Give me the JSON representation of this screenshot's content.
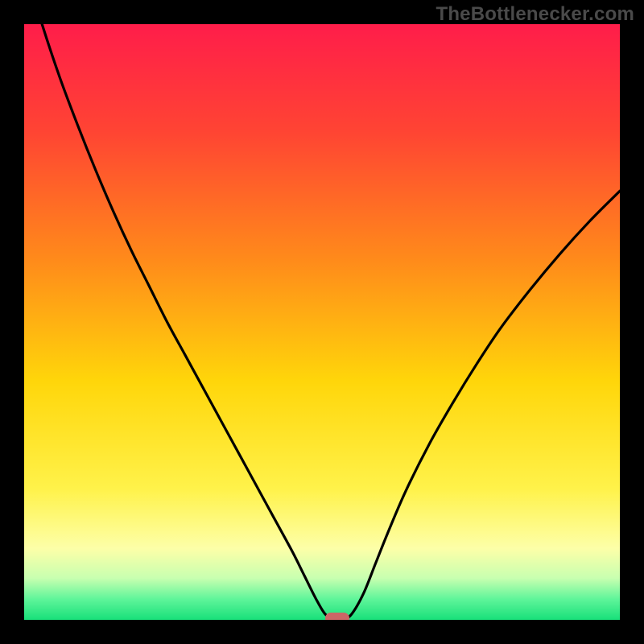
{
  "watermark": "TheBottlenecker.com",
  "chart_data": {
    "type": "line",
    "title": "",
    "xlabel": "",
    "ylabel": "",
    "xlim": [
      0,
      100
    ],
    "ylim": [
      0,
      100
    ],
    "gradient_stops": [
      {
        "offset": 0,
        "color": "#ff1d4a"
      },
      {
        "offset": 0.18,
        "color": "#ff4433"
      },
      {
        "offset": 0.4,
        "color": "#ff8c1a"
      },
      {
        "offset": 0.6,
        "color": "#ffd60a"
      },
      {
        "offset": 0.78,
        "color": "#fff24a"
      },
      {
        "offset": 0.88,
        "color": "#fdffa8"
      },
      {
        "offset": 0.93,
        "color": "#c8ffb0"
      },
      {
        "offset": 0.965,
        "color": "#5ff59a"
      },
      {
        "offset": 1.0,
        "color": "#18e07a"
      }
    ],
    "series": [
      {
        "name": "bottleneck-curve",
        "x": [
          0.0,
          3.0,
          6.0,
          9.0,
          12.0,
          15.0,
          18.0,
          21.0,
          24.0,
          27.0,
          30.0,
          33.0,
          36.0,
          39.0,
          42.0,
          45.0,
          47.0,
          49.0,
          50.5,
          52.0,
          53.5,
          55.0,
          57.0,
          59.0,
          61.0,
          64.0,
          68.0,
          72.0,
          76.0,
          80.0,
          85.0,
          90.0,
          95.0,
          100.0
        ],
        "values": [
          110.0,
          100.0,
          91.0,
          83.0,
          75.5,
          68.5,
          62.0,
          56.0,
          50.0,
          44.5,
          39.0,
          33.5,
          28.0,
          22.5,
          17.0,
          11.5,
          7.5,
          3.5,
          1.0,
          0.0,
          0.0,
          1.0,
          4.5,
          9.5,
          14.5,
          21.5,
          29.5,
          36.5,
          43.0,
          49.0,
          55.5,
          61.5,
          67.0,
          72.0
        ]
      }
    ],
    "marker": {
      "x": 52.5,
      "y": 0.0,
      "color": "#cc6666"
    }
  }
}
